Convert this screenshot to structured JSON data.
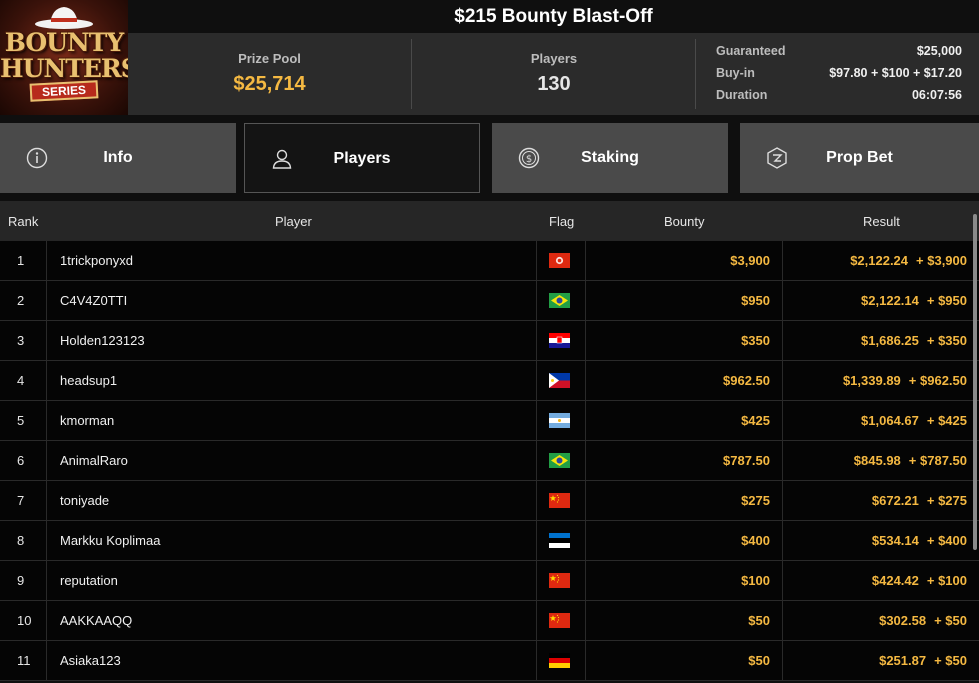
{
  "logo": {
    "line1": "BOUNTY",
    "line2": "HUNTERS",
    "line3": "SERIES"
  },
  "title": "$215 Bounty Blast-Off",
  "stats": {
    "prize_pool_label": "Prize Pool",
    "prize_pool_value": "$25,714",
    "players_label": "Players",
    "players_value": "130",
    "details": [
      {
        "label": "Guaranteed",
        "value": "$25,000"
      },
      {
        "label": "Buy-in",
        "value": "$97.80 + $100 + $17.20"
      },
      {
        "label": "Duration",
        "value": "06:07:56"
      }
    ]
  },
  "tabs": [
    {
      "label": "Info",
      "icon": "info-icon",
      "active": false
    },
    {
      "label": "Players",
      "icon": "user-icon",
      "active": true
    },
    {
      "label": "Staking",
      "icon": "dollar-coin-icon",
      "active": false
    },
    {
      "label": "Prop Bet",
      "icon": "prop-bet-icon",
      "active": false
    }
  ],
  "table": {
    "headers": {
      "rank": "Rank",
      "player": "Player",
      "flag": "Flag",
      "bounty": "Bounty",
      "result": "Result"
    },
    "rows": [
      {
        "rank": "1",
        "player": "1trickponyxd",
        "flag": "hong-kong",
        "bounty": "$3,900",
        "result": "$2,122.24",
        "result_bounty": "+ $3,900"
      },
      {
        "rank": "2",
        "player": "C4V4Z0TTI",
        "flag": "brazil",
        "bounty": "$950",
        "result": "$2,122.14",
        "result_bounty": "+ $950"
      },
      {
        "rank": "3",
        "player": "Holden123123",
        "flag": "croatia",
        "bounty": "$350",
        "result": "$1,686.25",
        "result_bounty": "+ $350"
      },
      {
        "rank": "4",
        "player": "headsup1",
        "flag": "philippines",
        "bounty": "$962.50",
        "result": "$1,339.89",
        "result_bounty": "+ $962.50"
      },
      {
        "rank": "5",
        "player": "kmorman",
        "flag": "argentina",
        "bounty": "$425",
        "result": "$1,064.67",
        "result_bounty": "+ $425"
      },
      {
        "rank": "6",
        "player": "AnimalRaro",
        "flag": "brazil",
        "bounty": "$787.50",
        "result": "$845.98",
        "result_bounty": "+ $787.50"
      },
      {
        "rank": "7",
        "player": "toniyade",
        "flag": "china",
        "bounty": "$275",
        "result": "$672.21",
        "result_bounty": "+ $275"
      },
      {
        "rank": "8",
        "player": "Markku Koplimaa",
        "flag": "estonia",
        "bounty": "$400",
        "result": "$534.14",
        "result_bounty": "+ $400"
      },
      {
        "rank": "9",
        "player": "reputation",
        "flag": "china",
        "bounty": "$100",
        "result": "$424.42",
        "result_bounty": "+ $100"
      },
      {
        "rank": "10",
        "player": "AAKKAAQQ",
        "flag": "china",
        "bounty": "$50",
        "result": "$302.58",
        "result_bounty": "+ $50"
      },
      {
        "rank": "11",
        "player": "Asiaka123",
        "flag": "germany",
        "bounty": "$50",
        "result": "$251.87",
        "result_bounty": "+ $50"
      }
    ]
  },
  "colors": {
    "accent": "#f5b942",
    "tab_bg": "#4a4a4a",
    "active_tab_bg": "#141414",
    "header_bg": "#262626",
    "stats_bg": "#2b2b2b"
  }
}
